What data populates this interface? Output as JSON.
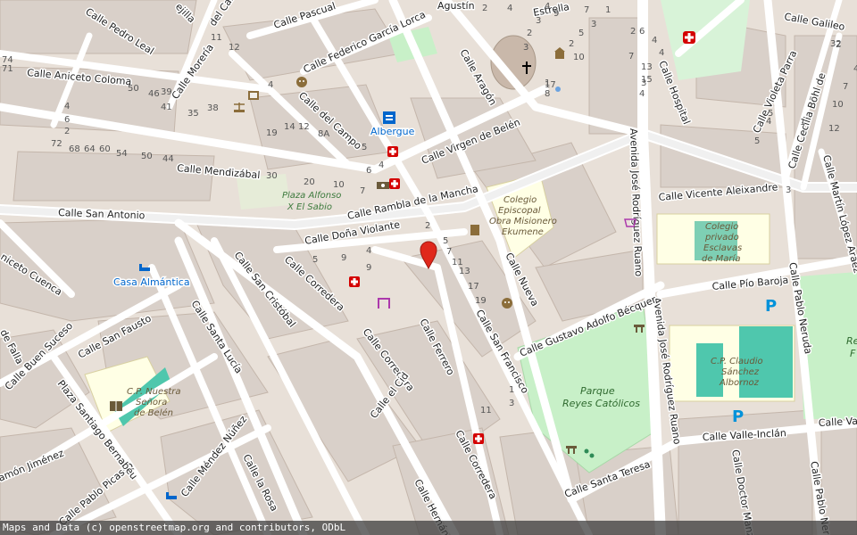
{
  "colors": {
    "background": "#e8e0d8",
    "building": "#d9d0c9",
    "road": "#ffffff",
    "park": "#c8f0c8",
    "school": "#ffffe5",
    "marker": "#e0271b"
  },
  "streets": {
    "galileo": "Calle Galileo",
    "hospital": "Calle Hospital",
    "violeta_parra": "Calle Violeta Parra",
    "cecilia_bohl": "Calle Cecilia Böhl de",
    "martin_lopez": "Calle Martín López Aráez",
    "vicente_aleixandre": "Calle Vicente Aleixandre",
    "pio_baroja": "Calle Pío Baroja",
    "pablo_neruda_1": "Calle Pablo Neruda",
    "pablo_neruda_2": "Calle Pablo Neruda",
    "valle_inclan": "Calle Valle-Inclán",
    "valle_short": "Calle Va",
    "doctor_manz": "Calle Doctor Manz",
    "av_jr_ruano_1": "Avenida José Rodríguez Ruano",
    "av_jr_ruano_2": "Avenida José Rodríguez Ruano",
    "santa_teresa": "Calle Santa Teresa",
    "gustavo": "Calle Gustavo Adolfo Bécquer",
    "nueva": "Calle Nueva",
    "san_francisco": "Calle San Francisco",
    "ferrero": "Calle Ferrero",
    "corredera_1": "Calle Corredera",
    "corredera_2": "Calle Corredera",
    "corredera_3": "Calle Corredera",
    "el_cid": "Calle el Cid",
    "hernan": "Calle Hernán Co",
    "la_rosa": "Calle la Rosa",
    "mendez_nunez": "Calle Méndez Núñez",
    "pablo_picasso": "Calle Pablo Picasso",
    "ramon_jimenez": "amón Jiménez",
    "santiago_bernabeu": "Plaza Santiago Bernabéu",
    "buen_suceso": "Calle Buen Suceso",
    "de_falla": "de Falla",
    "san_fausto": "Calle San Fausto",
    "santa_lucia": "Calle Santa Lucía",
    "san_cristobal": "Calle San Cristóbal",
    "aniceto_cuenca": "niceto Cuenca",
    "san_antonio": "Calle San Antonio",
    "dona_violante": "Calle Doña Violante",
    "rambla": "Calle Rambla de la Mancha",
    "mendizabal": "Calle Mendizábal",
    "virgen_belen": "Calle Virgen de Belén",
    "del_campo_1": "Calle del Campo",
    "del_campo_2": "del Campo",
    "aniceto_coloma": "Calle Aniceto Coloma",
    "pedro_leal": "Calle Pedro Leal",
    "moreria": "Calle Morería",
    "federico_garcia": "Calle Federico García Lorca",
    "pascual": "Calle Pascual",
    "aragon": "Calle Aragón",
    "agustin": "Agustín",
    "estrella": "Estrella",
    "rejilla": "ejilla"
  },
  "places": {
    "albergue": "Albergue",
    "casa_almantica": "Casa Almántica",
    "plaza_alfonso_1": "Plaza Alfonso",
    "plaza_alfonso_2": "X El Sabio",
    "parque_1": "Parque",
    "parque_2": "Reyes Católicos",
    "colegio_episcopal_1": "Colegio",
    "colegio_episcopal_2": "Episcopal",
    "colegio_episcopal_3": "Obra Misionero",
    "colegio_episcopal_4": "Ekumene",
    "colegio_privado_1": "Colegio",
    "colegio_privado_2": "privado",
    "colegio_privado_3": "Esclavas",
    "colegio_privado_4": "de María",
    "cp_claudio_1": "C.P. Claudio",
    "cp_claudio_2": "Sánchez",
    "cp_claudio_3": "Albornoz",
    "cp_nuestra_1": "C.P. Nuestra",
    "cp_nuestra_2": "Señora",
    "cp_nuestra_3": "de Belén",
    "re_1": "Re",
    "re_2": "F"
  },
  "house_numbers": [
    "74",
    "71",
    "4",
    "6",
    "2",
    "72",
    "68",
    "64",
    "60",
    "54",
    "50",
    "44",
    "50",
    "46",
    "41",
    "39",
    "35",
    "38",
    "4",
    "19",
    "14",
    "12",
    "8A",
    "5",
    "30",
    "20",
    "10",
    "7",
    "6",
    "4",
    "12",
    "11",
    "1",
    "2",
    "7",
    "3",
    "4",
    "10",
    "9",
    "5",
    "9",
    "4",
    "2",
    "5",
    "7",
    "11",
    "13",
    "17",
    "19",
    "11",
    "3",
    "1",
    "5",
    "3",
    "2",
    "6",
    "4",
    "4",
    "7",
    "1",
    "13",
    "15",
    "2",
    "4",
    "7",
    "10",
    "12",
    "3",
    "4",
    "5",
    "5",
    "1",
    "32",
    "9",
    "4",
    "3",
    "2",
    "3",
    "2",
    "4",
    "17",
    "8"
  ],
  "icons": [
    "hospital-icon",
    "pharmacy-icon",
    "pharmacy-icon",
    "pharmacy-icon",
    "pharmacy-icon",
    "pharmacy-icon",
    "theatre-icon",
    "theatre-icon",
    "theatre-icon",
    "cinema-icon",
    "courthouse-icon",
    "library-icon",
    "hostel-icon",
    "hotel-icon",
    "bed-icon",
    "church-icon",
    "museum-icon",
    "museum-icon",
    "atm-icon",
    "shop-icon",
    "parking-icon",
    "parking-icon",
    "playground-icon",
    "picnic-icon",
    "toilet-icon",
    "marker-pin-icon"
  ],
  "attribution": "Maps and Data (c) openstreetmap.org and contributors, ODbL"
}
